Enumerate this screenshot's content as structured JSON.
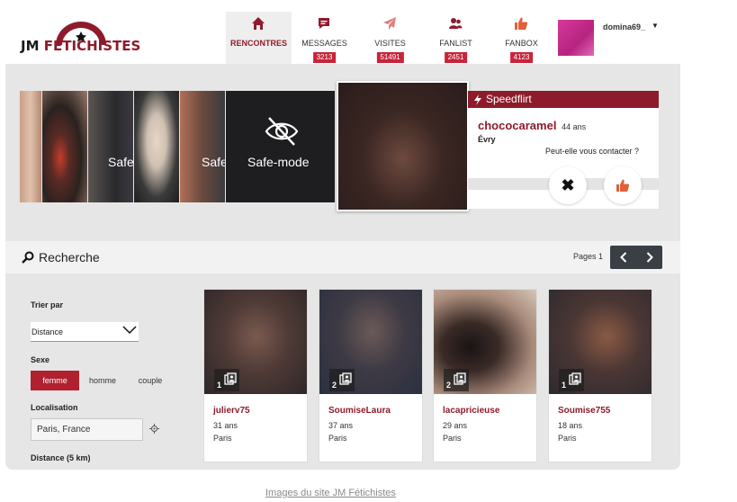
{
  "brand": {
    "name_part1": "JM",
    "name_part2": "FETICHISTES",
    "color": "#8e1b2b"
  },
  "nav": [
    {
      "label": "RENCONTRES",
      "icon": "home-icon",
      "badge": null,
      "active": true
    },
    {
      "label": "MESSAGES",
      "icon": "chat-bubble-icon",
      "badge": "3213"
    },
    {
      "label": "VISITES",
      "icon": "paper-plane-icon",
      "badge": "51491"
    },
    {
      "label": "FANLIST",
      "icon": "users-icon",
      "badge": "2451"
    },
    {
      "label": "FANBOX",
      "icon": "thumbs-up-icon",
      "badge": "4123"
    }
  ],
  "user": {
    "username": "domina69_"
  },
  "carousel": {
    "safe_mode_label": "Safe-mode",
    "safe_mode_partial_1": "Safe",
    "safe_mode_partial_2": "Safe"
  },
  "speedflirt": {
    "title": "Speedflirt",
    "name": "chococaramel",
    "age": "44 ans",
    "city": "Évry",
    "question": "Peut-elle vous contacter ?"
  },
  "search": {
    "title": "Recherche",
    "pages_label": "Pages 1"
  },
  "filters": {
    "sort_label": "Trier par",
    "sort_value": "Distance",
    "sex_label": "Sexe",
    "sex_options": [
      "femme",
      "homme",
      "couple"
    ],
    "sex_selected": "femme",
    "location_label": "Localisation",
    "location_value": "Paris, France",
    "distance_label": "Distance (5 km)"
  },
  "results": [
    {
      "name": "julierv75",
      "age": "31 ans",
      "city": "Paris",
      "photos": "1"
    },
    {
      "name": "SoumiseLaura",
      "age": "37 ans",
      "city": "Paris",
      "photos": "2"
    },
    {
      "name": "lacapricieuse",
      "age": "29 ans",
      "city": "Paris",
      "photos": "2"
    },
    {
      "name": "Soumise755",
      "age": "18 ans",
      "city": "Paris",
      "photos": "1"
    }
  ],
  "caption": "Images du site JM Fétichistes",
  "colors": {
    "accent": "#8e1b2b",
    "badge": "#c8243a",
    "pager": "#3a3f45"
  }
}
